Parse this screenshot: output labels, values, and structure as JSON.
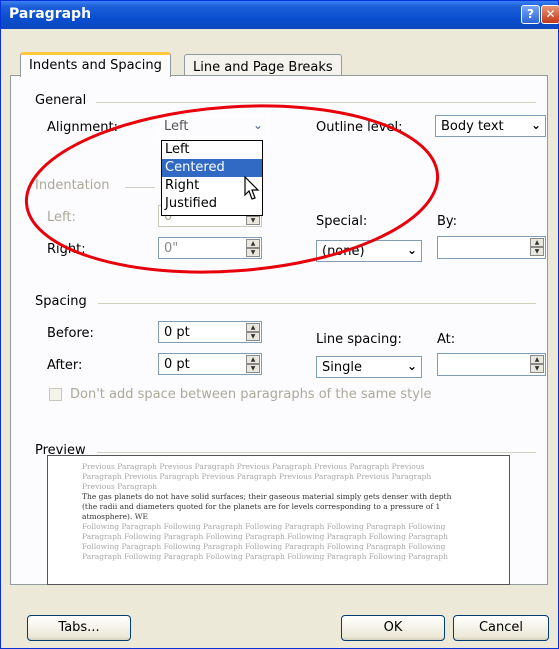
{
  "window": {
    "title": "Paragraph",
    "help_glyph": "?",
    "close_glyph": "✕"
  },
  "tabs": [
    {
      "label": "Indents and Spacing",
      "active": true
    },
    {
      "label": "Line and Page Breaks",
      "active": false
    }
  ],
  "general": {
    "heading": "General",
    "alignment_label": "Alignment:",
    "alignment_value": "Left",
    "alignment_options": [
      "Left",
      "Centered",
      "Right",
      "Justified"
    ],
    "highlighted_option": "Centered",
    "outline_label": "Outline level:",
    "outline_value": "Body text"
  },
  "indentation": {
    "heading": "Indentation",
    "left_label": "Left:",
    "left_value": "0\"",
    "right_label": "Right:",
    "right_value": "0\"",
    "special_label": "Special:",
    "special_value": "(none)",
    "by_label": "By:",
    "by_value": ""
  },
  "spacing": {
    "heading": "Spacing",
    "before_label": "Before:",
    "before_value": "0 pt",
    "after_label": "After:",
    "after_value": "0 pt",
    "line_spacing_label": "Line spacing:",
    "line_spacing_value": "Single",
    "at_label": "At:",
    "at_value": "",
    "dont_add_label": "Don't add space between paragraphs of the same style",
    "dont_add_checked": false
  },
  "preview": {
    "heading": "Preview",
    "prev_lines": [
      "Previous Paragraph Previous Paragraph Previous Paragraph Previous Paragraph Previous",
      "Paragraph Previous Paragraph Previous Paragraph Previous Paragraph Previous Paragraph",
      "Previous Paragraph"
    ],
    "body_lines": [
      "The gas planets do not have solid surfaces; their gaseous material simply gets denser with depth",
      "(the radii and diameters quoted for the planets are for levels corresponding to a pressure of 1",
      "atmosphere). WE"
    ],
    "follow_lines": [
      "Following Paragraph Following Paragraph Following Paragraph Following Paragraph Following",
      "Paragraph Following Paragraph Following Paragraph Following Paragraph Following Paragraph",
      "Following Paragraph Following Paragraph Following Paragraph Following Paragraph Following",
      "Paragraph Following Paragraph Following Paragraph Following Paragraph Following Paragraph"
    ]
  },
  "buttons": {
    "tabs": "Tabs...",
    "ok": "OK",
    "cancel": "Cancel"
  },
  "colors": {
    "title_bar": "#0a4fd0",
    "dialog_bg": "#ece9d8",
    "selection": "#316ac5",
    "annotation": "#e8000b"
  }
}
